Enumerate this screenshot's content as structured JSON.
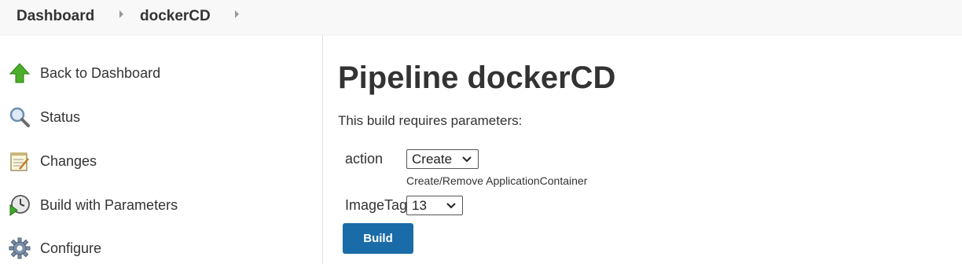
{
  "breadcrumb": {
    "items": [
      "Dashboard",
      "dockerCD"
    ]
  },
  "sidebar": {
    "items": [
      {
        "label": "Back to Dashboard",
        "icon": "up-arrow-icon"
      },
      {
        "label": "Status",
        "icon": "magnifier-icon"
      },
      {
        "label": "Changes",
        "icon": "notepad-icon"
      },
      {
        "label": "Build with Parameters",
        "icon": "clock-play-icon"
      },
      {
        "label": "Configure",
        "icon": "gear-icon"
      }
    ]
  },
  "main": {
    "title": "Pipeline dockerCD",
    "subtitle": "This build requires parameters:",
    "params": [
      {
        "name": "action",
        "value": "Create",
        "description": "Create/Remove ApplicationContainer"
      },
      {
        "name": "ImageTag",
        "value": "13",
        "description": ""
      }
    ],
    "build_label": "Build"
  },
  "colors": {
    "accent": "#1a6ca8",
    "breadcrumb_bg": "#f8f8f8"
  }
}
